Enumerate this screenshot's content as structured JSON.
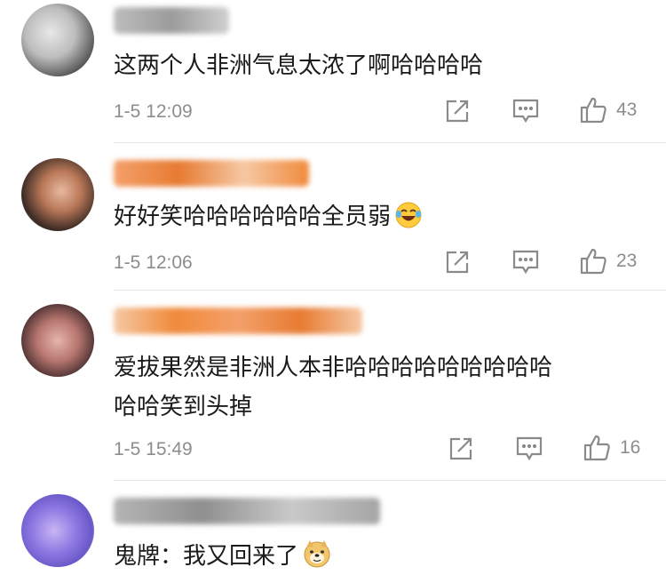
{
  "comments": [
    {
      "text": "这两个人非洲气息太浓了啊哈哈哈哈",
      "time": "1-5 12:09",
      "likes": "43",
      "emoji": ""
    },
    {
      "text": "好好笑哈哈哈哈哈哈全员弱",
      "time": "1-5 12:06",
      "likes": "23",
      "emoji": "laughing-crying-emoji"
    },
    {
      "text_line1": "爱拔果然是非洲人本非哈哈哈哈哈哈哈哈哈",
      "text_line2": "哈哈笑到头掉",
      "time": "1-5 15:49",
      "likes": "16",
      "emoji": ""
    },
    {
      "text": "鬼牌：我又回来了",
      "emoji": "doge-emoji"
    }
  ],
  "icons": {
    "share": "share-icon",
    "reply": "reply-comment-icon",
    "like": "thumbs-up-icon"
  },
  "colors": {
    "text": "#1a1a1a",
    "meta": "#8d8d8d",
    "icon": "#8a8a8a",
    "divider": "#e6e6e6"
  }
}
